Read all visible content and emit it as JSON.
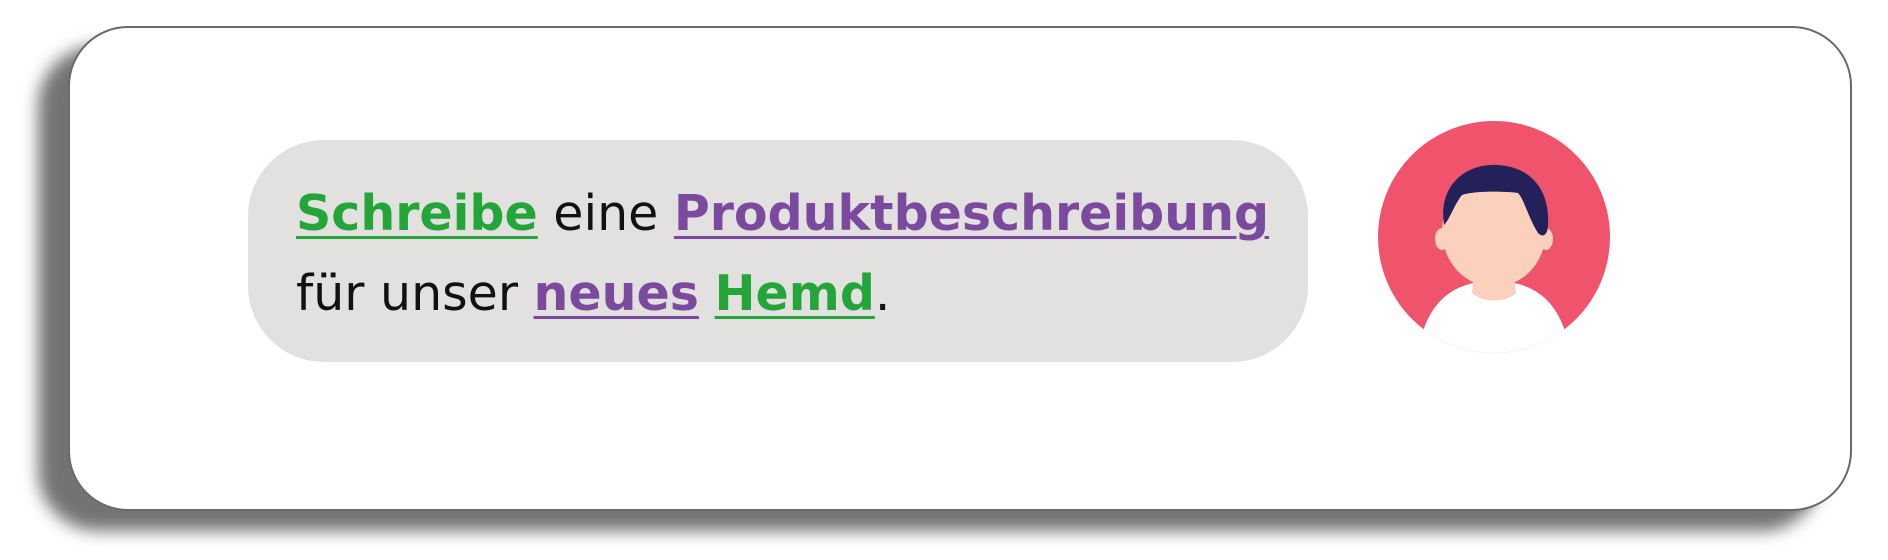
{
  "message": {
    "line1": [
      {
        "text": "Schreibe",
        "style": "keyword",
        "color": "#23a53a"
      },
      {
        "text": " eine ",
        "style": "plain"
      },
      {
        "text": "Produktbeschreibung",
        "style": "keyword",
        "color": "#7b4a9e"
      }
    ],
    "line2": [
      {
        "text": "für unser ",
        "style": "plain"
      },
      {
        "text": "neues",
        "style": "keyword",
        "color": "#7b4a9e"
      },
      {
        "text": " ",
        "style": "plain"
      },
      {
        "text": "Hemd",
        "style": "keyword",
        "color": "#23a53a"
      },
      {
        "text": ".",
        "style": "plain"
      }
    ]
  },
  "avatar": {
    "icon": "user-avatar-icon",
    "background_color": "#f0536c",
    "hair_color": "#23205a",
    "skin_color": "#fbd1bd"
  },
  "colors": {
    "green_keyword": "#23a53a",
    "purple_keyword": "#7b4a9e",
    "bubble_background": "#e2e1df"
  }
}
